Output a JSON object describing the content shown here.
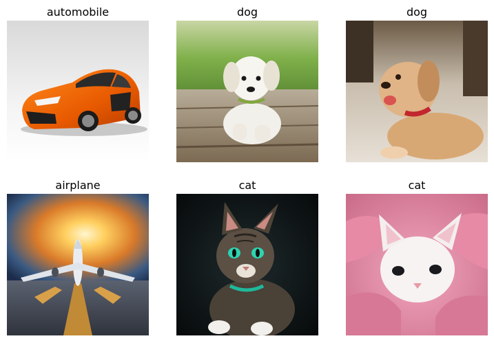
{
  "panels": [
    {
      "label": "automobile",
      "image": "orange-sports-car"
    },
    {
      "label": "dog",
      "image": "white-puppy-on-deck"
    },
    {
      "label": "dog",
      "image": "golden-puppy-red-collar"
    },
    {
      "label": "airplane",
      "image": "airplane-on-runway-sunset"
    },
    {
      "label": "cat",
      "image": "tabby-cat-dark-background"
    },
    {
      "label": "cat",
      "image": "white-kitten-pink-blanket"
    }
  ]
}
